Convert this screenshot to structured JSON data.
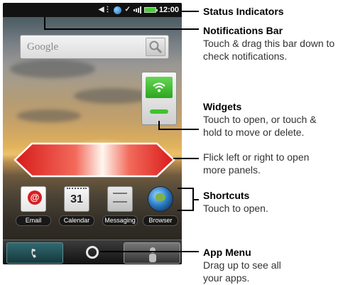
{
  "phone": {
    "status_bar": {
      "time": "12:00"
    },
    "search_widget": {
      "logo": "Google"
    },
    "calendar_date": "31",
    "shortcuts": [
      {
        "label": "Email",
        "icon": "email-icon"
      },
      {
        "label": "Calendar",
        "icon": "calendar-icon"
      },
      {
        "label": "Messaging",
        "icon": "messaging-icon"
      },
      {
        "label": "Browser",
        "icon": "globe-icon"
      }
    ],
    "dock": {
      "left": "phone-icon",
      "center": "app-menu-icon",
      "right": "contacts-icon"
    }
  },
  "annotations": {
    "status_indicators": {
      "title": "Status Indicators"
    },
    "notifications_bar": {
      "title": "Notifications Bar",
      "desc": "Touch & drag this bar down to\ncheck notifications."
    },
    "widgets": {
      "title": "Widgets",
      "desc": "Touch to open, or touch &\nhold to move or delete."
    },
    "flick": {
      "desc": "Flick left or right to open\nmore panels."
    },
    "shortcuts": {
      "title": "Shortcuts",
      "desc": "Touch to open."
    },
    "app_menu": {
      "title": "App Menu",
      "desc": "Drag up to see all\nyour apps."
    }
  },
  "colors": {
    "arrow_red": "#e0201f",
    "widget_green": "#3fc22e",
    "callout_line": "#000000"
  }
}
